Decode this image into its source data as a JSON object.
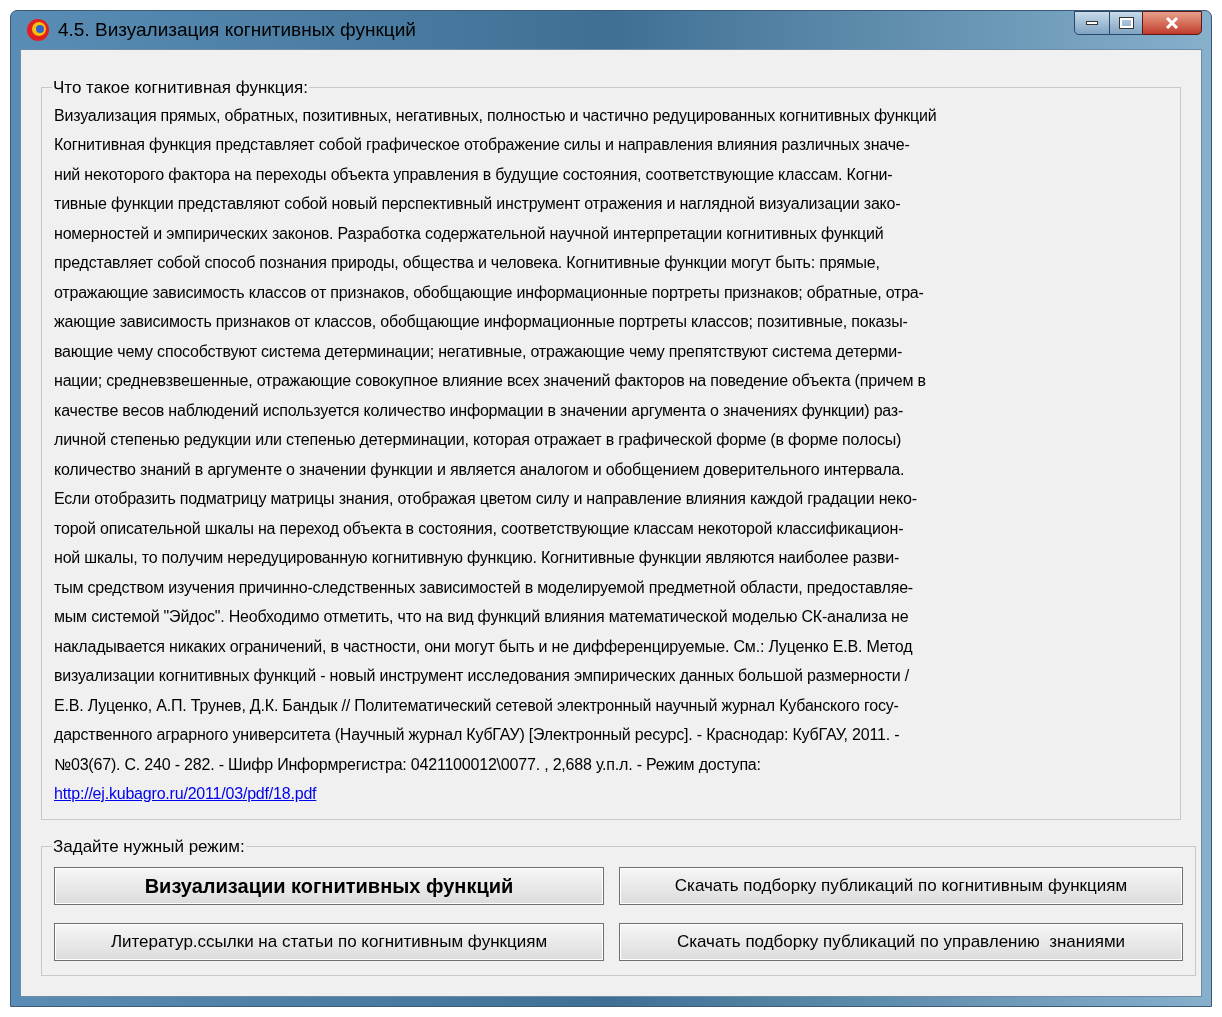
{
  "window": {
    "title": "4.5. Визуализация когнитивных функций"
  },
  "info_group": {
    "legend": "Что такое когнитивная функция:",
    "lines": [
      "Визуализация прямых, обратных, позитивных, негативных, полностью и частично редуцированных когнитивных функций",
      "Когнитивная функция представляет собой графическое отображение силы и направления влияния различных значе-",
      "ний некоторого фактора на переходы объекта управления в будущие состояния, соответствующие классам. Когни-",
      "тивные функции представляют собой новый перспективный инструмент отражения и наглядной визуализации зако-",
      "номерностей и эмпирических законов. Разработка содержательной научной интерпретации когнитивных функций",
      "представляет собой способ познания природы, общества и человека. Когнитивные функции могут быть: прямые,",
      "отражающие зависимость классов от признаков, обобщающие информационные портреты признаков; обратные, отра-",
      "жающие зависимость признаков от классов, обобщающие информационные портреты классов; позитивные, показы-",
      "вающие чему способствуют система детерминации; негативные, отражающие чему препятствуют система детерми-",
      "нации; средневзвешенные, отражающие совокупное влияние всех значений факторов на поведение объекта (причем в",
      "качестве весов наблюдений используется количество информации в значении аргумента о значениях функции) раз-",
      "личной степенью редукции или степенью детерминации, которая отражает в графической форме (в форме полосы)",
      "количество знаний в аргументе о значении функции и является аналогом и обобщением доверительного интервала.",
      "Если отобразить подматрицу матрицы знания, отображая цветом силу и направление влияния каждой градации неко-",
      "торой описательной шкалы на переход объекта в состояния, соответствующие классам некоторой классификацион-",
      "ной шкалы, то получим нередуцированную когнитивную функцию. Когнитивные функции являются наиболее разви-",
      "тым средством изучения причинно-следственных зависимостей в моделируемой предметной области, предоставляе-",
      "мым системой \"Эйдос\". Необходимо отметить, что на вид функций влияния математической моделью СК-анализа не",
      "накладывается никаких ограничений, в частности, они могут быть и не дифференцируемые. См.: Луценко Е.В. Метод",
      "визуализации когнитивных функций - новый инструмент исследования эмпирических данных большой размерности /",
      "Е.В. Луценко, А.П. Трунев, Д.К. Бандык // Политематический сетевой электронный научный журнал Кубанского госу-",
      "дарственного аграрного университета (Научный журнал КубГАУ) [Электронный ресурс]. - Краснодар: КубГАУ, 2011. -",
      "№03(67). С. 240 - 282. - Шифр Информрегистра: 0421100012\\0077. , 2,688 у.п.л. - Режим доступа:"
    ],
    "link": "http://ej.kubagro.ru/2011/03/pdf/18.pdf"
  },
  "mode_group": {
    "legend": "Задайте нужный режим:",
    "buttons": [
      {
        "label": "Визуализации когнитивных функций",
        "bold": true
      },
      {
        "label": "Скачать подборку публикаций по когнитивным функциям",
        "bold": false
      },
      {
        "label": "Литератур.ссылки на статьи по когнитивным функциям",
        "bold": false
      },
      {
        "label": "Скачать подборку публикаций по управлению  знаниями",
        "bold": false
      }
    ]
  }
}
